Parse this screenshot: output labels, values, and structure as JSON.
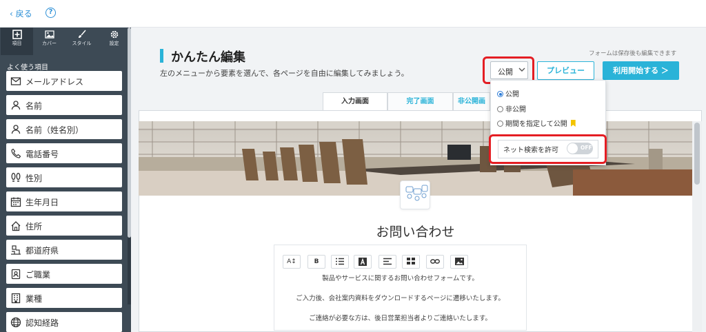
{
  "topbar": {
    "back_label": "戻る",
    "help_glyph": "?"
  },
  "sidebar": {
    "tabs": [
      {
        "label": "項目",
        "icon": "plus-square-icon"
      },
      {
        "label": "カバー",
        "icon": "image-icon"
      },
      {
        "label": "スタイル",
        "icon": "brush-icon"
      },
      {
        "label": "設定",
        "icon": "gear-icon"
      }
    ],
    "section_title": "よく使う項目",
    "items": [
      {
        "label": "メールアドレス",
        "icon": "mail-icon"
      },
      {
        "label": "名前",
        "icon": "person-icon"
      },
      {
        "label": "名前（姓名別）",
        "icon": "person-icon"
      },
      {
        "label": "電話番号",
        "icon": "phone-icon"
      },
      {
        "label": "性別",
        "icon": "footprints-icon"
      },
      {
        "label": "生年月日",
        "icon": "calendar-icon"
      },
      {
        "label": "住所",
        "icon": "home-icon"
      },
      {
        "label": "都道府県",
        "icon": "map-pin-icon"
      },
      {
        "label": "ご職業",
        "icon": "id-badge-icon"
      },
      {
        "label": "業種",
        "icon": "building-icon"
      },
      {
        "label": "認知経路",
        "icon": "globe-icon"
      }
    ]
  },
  "header": {
    "title": "かんたん編集",
    "subtitle": "左のメニューから要素を選んで、各ページを自由に編集してみましょう。",
    "note": "フォームは保存後も編集できます",
    "publish_select": "公開",
    "preview_button": "プレビュー",
    "start_button": "利用開始する ＞"
  },
  "tabs": [
    {
      "label": "入力画面",
      "active": true
    },
    {
      "label": "完了画面",
      "active": false
    },
    {
      "label": "非公開画",
      "active": false
    }
  ],
  "dropdown": {
    "options": [
      {
        "label": "公開",
        "selected": true
      },
      {
        "label": "非公開",
        "selected": false
      },
      {
        "label": "期間を指定して公開",
        "selected": false
      }
    ],
    "net_search_label": "ネット検索を許可",
    "toggle_text": "OFF",
    "toggle_on": false
  },
  "form": {
    "title": "お問い合わせ",
    "toolbar": [
      "A↕",
      "B",
      "list",
      "A",
      "align",
      "table",
      "link",
      "image"
    ],
    "body_lines": [
      "製品やサービスに関するお問い合わせフォームです。",
      "ご入力後、会社案内資料をダウンロードするページに遷移いたします。",
      "ご連絡が必要な方は、後日営業担当者よりご連絡いたします。"
    ]
  },
  "colors": {
    "accent": "#2ab3d8",
    "highlight": "#e41d23",
    "sidebar_bg": "#3d4a55",
    "link": "#2b8fd6"
  }
}
